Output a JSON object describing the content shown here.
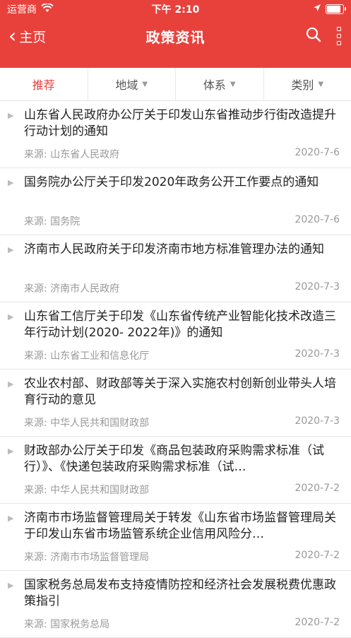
{
  "status_bar": {
    "carrier": "运营商",
    "time": "下午 2:10"
  },
  "navbar": {
    "back_label": "主页",
    "title": "政策资讯"
  },
  "filters": [
    {
      "label": "推荐",
      "active": true
    },
    {
      "label": "地域",
      "active": false
    },
    {
      "label": "体系",
      "active": false
    },
    {
      "label": "类别",
      "active": false
    }
  ],
  "articles": [
    {
      "title": "山东省人民政府办公厅关于印发山东省推动步行街改造提升行动计划的通知",
      "source": "来源: 山东省人民政府",
      "date": "2020-7-6"
    },
    {
      "title": "国务院办公厅关于印发2020年政务公开工作要点的通知",
      "source": "来源: 国务院",
      "date": "2020-7-6"
    },
    {
      "title": "济南市人民政府关于印发济南市地方标准管理办法的通知",
      "source": "来源: 济南市人民政府",
      "date": "2020-7-3"
    },
    {
      "title": "山东省工信厅关于印发《山东省传统产业智能化技术改造三年行动计划(2020- 2022年)》的通知",
      "source": "来源: 山东省工业和信息化厅",
      "date": "2020-7-3"
    },
    {
      "title": "农业农村部、财政部等关于深入实施农村创新创业带头人培育行动的意见",
      "source": "来源: 中华人民共和国财政部",
      "date": "2020-7-3"
    },
    {
      "title": "财政部办公厅关于印发《商品包装政府采购需求标准（试行）》、《快递包装政府采购需求标准（试…",
      "source": "来源: 中华人民共和国财政部",
      "date": "2020-7-2"
    },
    {
      "title": "济南市市场监督管理局关于转发《山东省市场监督管理局关于印发山东省市场监管系统企业信用风险分…",
      "source": "来源: 济南市市场监督管理局",
      "date": "2020-7-2"
    },
    {
      "title": "国家税务总局发布支持疫情防控和经济社会发展税费优惠政策指引",
      "source": "来源: 国家税务总局",
      "date": "2020-7-2"
    }
  ],
  "colors": {
    "accent": "#e8413c"
  }
}
